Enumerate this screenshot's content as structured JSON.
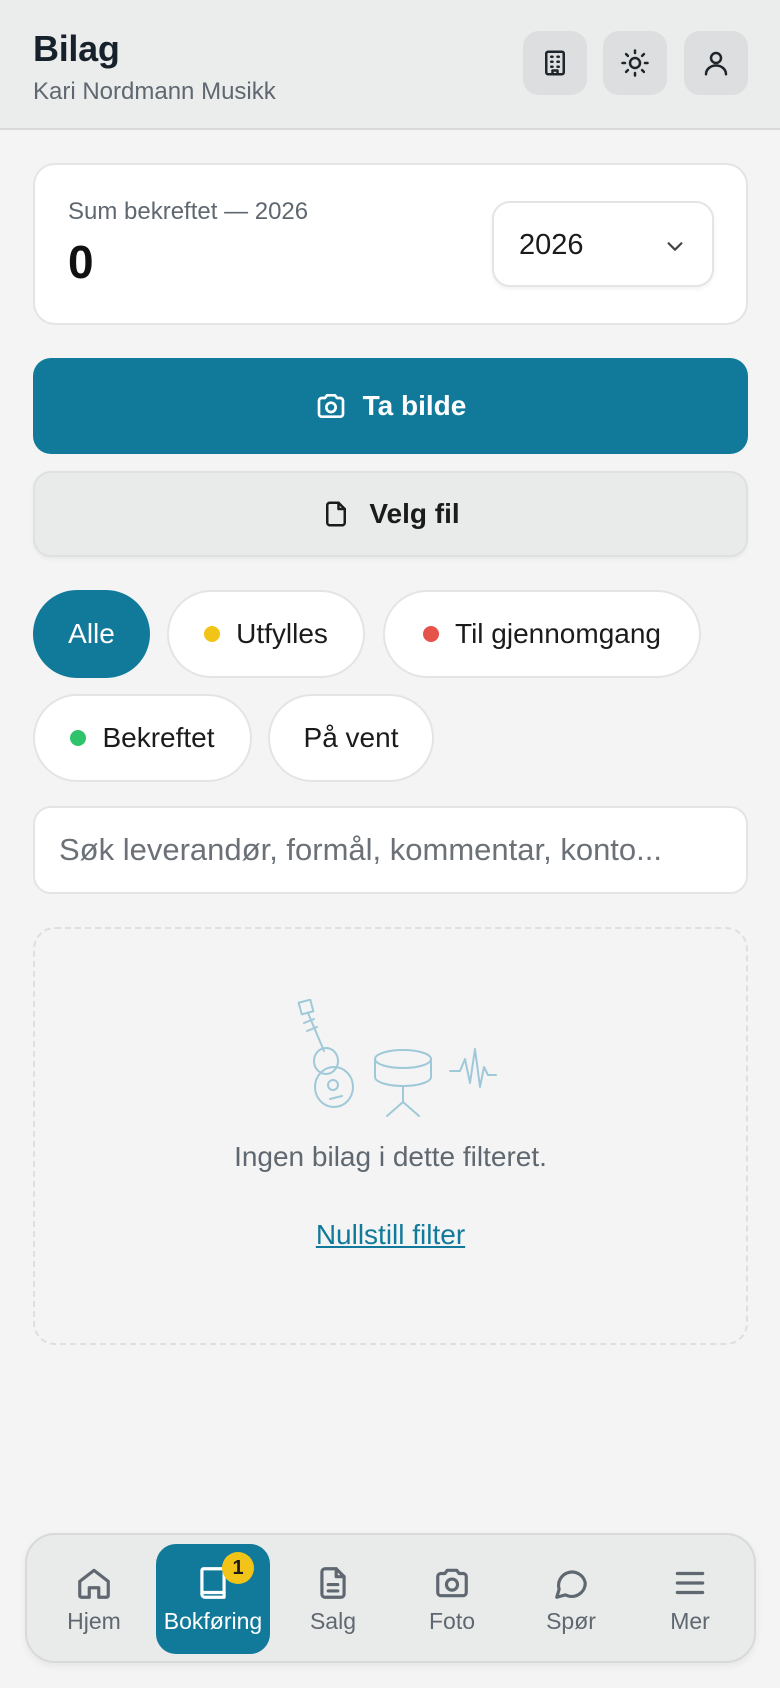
{
  "header": {
    "title": "Bilag",
    "subtitle": "Kari Nordmann Musikk",
    "buttons": [
      {
        "icon": "building-icon"
      },
      {
        "icon": "sun-icon"
      },
      {
        "icon": "user-icon"
      }
    ]
  },
  "summary": {
    "label": "Sum bekreftet — 2026",
    "value": "0",
    "year_select": {
      "selected": "2026"
    }
  },
  "actions": {
    "primary_label": "Ta bilde",
    "primary_icon": "camera-icon",
    "secondary_label": "Velg fil",
    "secondary_icon": "file-icon"
  },
  "filters": [
    {
      "label": "Alle",
      "active": true
    },
    {
      "label": "Utfylles",
      "dot_color": "#f2c418"
    },
    {
      "label": "Til gjennomgang",
      "dot_color": "#e5534b"
    },
    {
      "label": "Bekreftet",
      "dot_color": "#2fc46b"
    },
    {
      "label": "På vent"
    }
  ],
  "search": {
    "placeholder": "Søk leverandør, formål, kommentar, konto...",
    "value": ""
  },
  "empty_state": {
    "illustration": "music-instruments-illustration",
    "message": "Ingen bilag i dette filteret.",
    "reset_link": "Nullstill filter"
  },
  "bottom_nav": [
    {
      "label": "Hjem",
      "icon": "home-icon"
    },
    {
      "label": "Bokføring",
      "icon": "book-icon",
      "active": true,
      "badge": "1"
    },
    {
      "label": "Salg",
      "icon": "document-icon"
    },
    {
      "label": "Foto",
      "icon": "camera-icon"
    },
    {
      "label": "Spør",
      "icon": "chat-icon"
    },
    {
      "label": "Mer",
      "icon": "menu-icon"
    }
  ],
  "colors": {
    "accent": "#117a9a",
    "background": "#f4f4f4",
    "badge": "#f2c418"
  }
}
